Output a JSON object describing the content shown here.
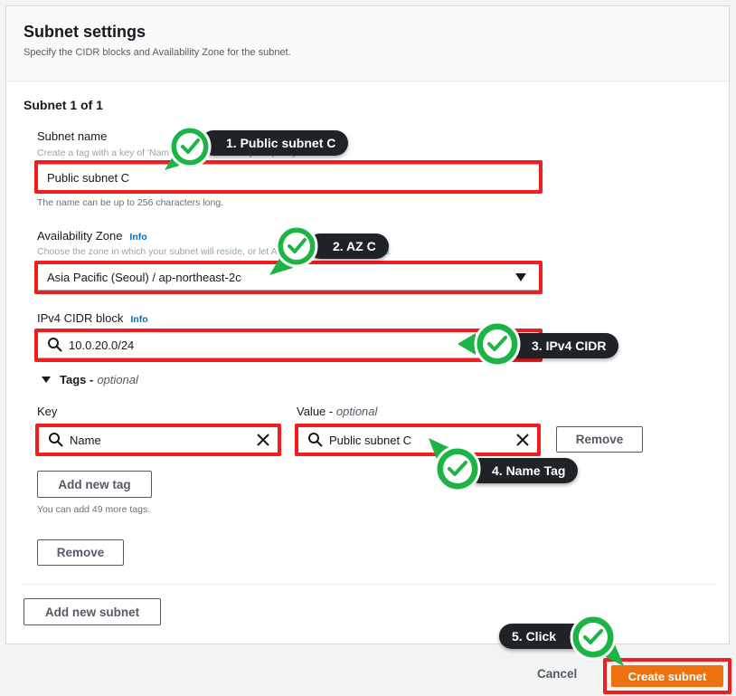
{
  "settings": {
    "title": "Subnet settings",
    "description": "Specify the CIDR blocks and Availability Zone for the subnet."
  },
  "subnet": {
    "heading": "Subnet 1 of 1",
    "name_label": "Subnet name",
    "name_hint": "Create a tag with a key of 'Name' and a value that you specify.",
    "name_value": "Public subnet C",
    "name_footer": "The name can be up to 256 characters long.",
    "az_label": "Availability Zone",
    "az_info": "Info",
    "az_hint": "Choose the zone in which your subnet will reside, or let Amazon choose one for you.",
    "az_value": "Asia Pacific (Seoul) / ap-northeast-2c",
    "cidr_label": "IPv4 CIDR block",
    "cidr_info": "Info",
    "cidr_value": "10.0.20.0/24",
    "tags_title": "Tags -",
    "tags_optional": "optional",
    "key_label": "Key",
    "value_label": "Value -",
    "value_optional": "optional",
    "key_value": "Name",
    "tag_value": "Public subnet C",
    "remove_tag_label": "Remove",
    "add_tag_label": "Add new tag",
    "tag_limit_text": "You can add 49 more tags.",
    "remove_subnet_label": "Remove"
  },
  "add_subnet_label": "Add new subnet",
  "footer": {
    "cancel_label": "Cancel",
    "create_label": "Create subnet"
  },
  "annotations": {
    "step1": "1. Public subnet C",
    "step2": "2. AZ C",
    "step3": "3. IPv4 CIDR",
    "step4": "4. Name Tag",
    "step5": "5. Click"
  },
  "colors": {
    "highlight_red": "#f21d1d",
    "check_green": "#1db446",
    "primary_orange": "#ec7211",
    "link_blue": "#0073bb"
  }
}
